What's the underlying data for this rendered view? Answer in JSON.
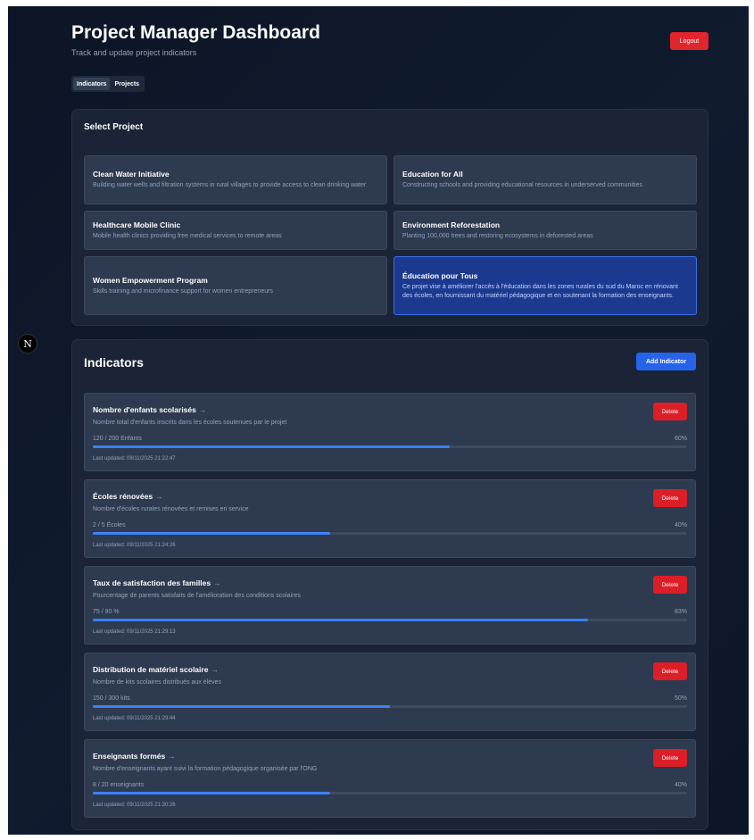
{
  "header": {
    "title": "Project Manager Dashboard",
    "subtitle": "Track and update project indicators",
    "logout_label": "Logout"
  },
  "tabs": [
    {
      "label": "Indicators",
      "active": true
    },
    {
      "label": "Projects",
      "active": false
    }
  ],
  "project_selector": {
    "title": "Select Project",
    "projects": [
      {
        "name": "Clean Water Initiative",
        "description": "Building water wells and filtration systems in rural villages to provide access to clean drinking water",
        "selected": false
      },
      {
        "name": "Education for All",
        "description": "Constructing schools and providing educational resources in underserved communities",
        "selected": false
      },
      {
        "name": "Healthcare Mobile Clinic",
        "description": "Mobile health clinics providing free medical services to remote areas",
        "selected": false
      },
      {
        "name": "Environment Reforestation",
        "description": "Planting 100,000 trees and restoring ecosystems in deforested areas",
        "selected": false
      },
      {
        "name": "Women Empowerment Program",
        "description": "Skills training and microfinance support for women entrepreneurs",
        "selected": false
      },
      {
        "name": "Éducation pour Tous",
        "description": "Ce projet vise à améliorer l'accès à l'éducation dans les zones rurales du sud du Maroc en rénovant des écoles, en fournissant du matériel pédagogique et en soutenant la formation des enseignants.",
        "selected": true
      }
    ]
  },
  "indicators": {
    "title": "Indicators",
    "add_label": "Add Indicator",
    "items": [
      {
        "name": "Nombre d'enfants scolarisés",
        "description": "Nombre total d'enfants inscrits dans les écoles soutenues par le projet",
        "value_text": "120 / 200 Enfants",
        "percent_text": "60%",
        "progress": 0.6,
        "updated": "Last updated: 09/11/2025 21:22:47",
        "delete_label": "Delete"
      },
      {
        "name": "Écoles rénovées",
        "description": "Nombre d'écoles rurales rénovées et remises en service",
        "value_text": "2 / 5 Écoles",
        "percent_text": "40%",
        "progress": 0.4,
        "updated": "Last updated: 09/11/2025 21:24:26",
        "delete_label": "Delete"
      },
      {
        "name": "Taux de satisfaction des familles",
        "description": "Pourcentage de parents satisfaits de l'amélioration des conditions scolaires",
        "value_text": "75 / 90 %",
        "percent_text": "83%",
        "progress": 0.833,
        "updated": "Last updated: 09/11/2025 21:29:13",
        "delete_label": "Delete"
      },
      {
        "name": "Distribution de matériel scolaire",
        "description": "Nombre de kits scolaires distribués aux élèves",
        "value_text": "150 / 300 kits",
        "percent_text": "50%",
        "progress": 0.5,
        "updated": "Last updated: 09/11/2025 21:29:44",
        "delete_label": "Delete"
      },
      {
        "name": "Enseignants formés",
        "description": "Nombre d'enseignants ayant suivi la formation pédagogique organisée par l'ONG",
        "value_text": "8 / 20 enseignants",
        "percent_text": "40%",
        "progress": 0.4,
        "updated": "Last updated: 09/11/2025 21:30:26",
        "delete_label": "Delete"
      }
    ]
  },
  "colors": {
    "accent": "#2563eb",
    "danger": "#dc1f27",
    "progress": "#3b82f6",
    "selected_card": "#1b3a8f"
  },
  "icons": {
    "framework_badge": "N",
    "indicator_arrow": "→"
  }
}
